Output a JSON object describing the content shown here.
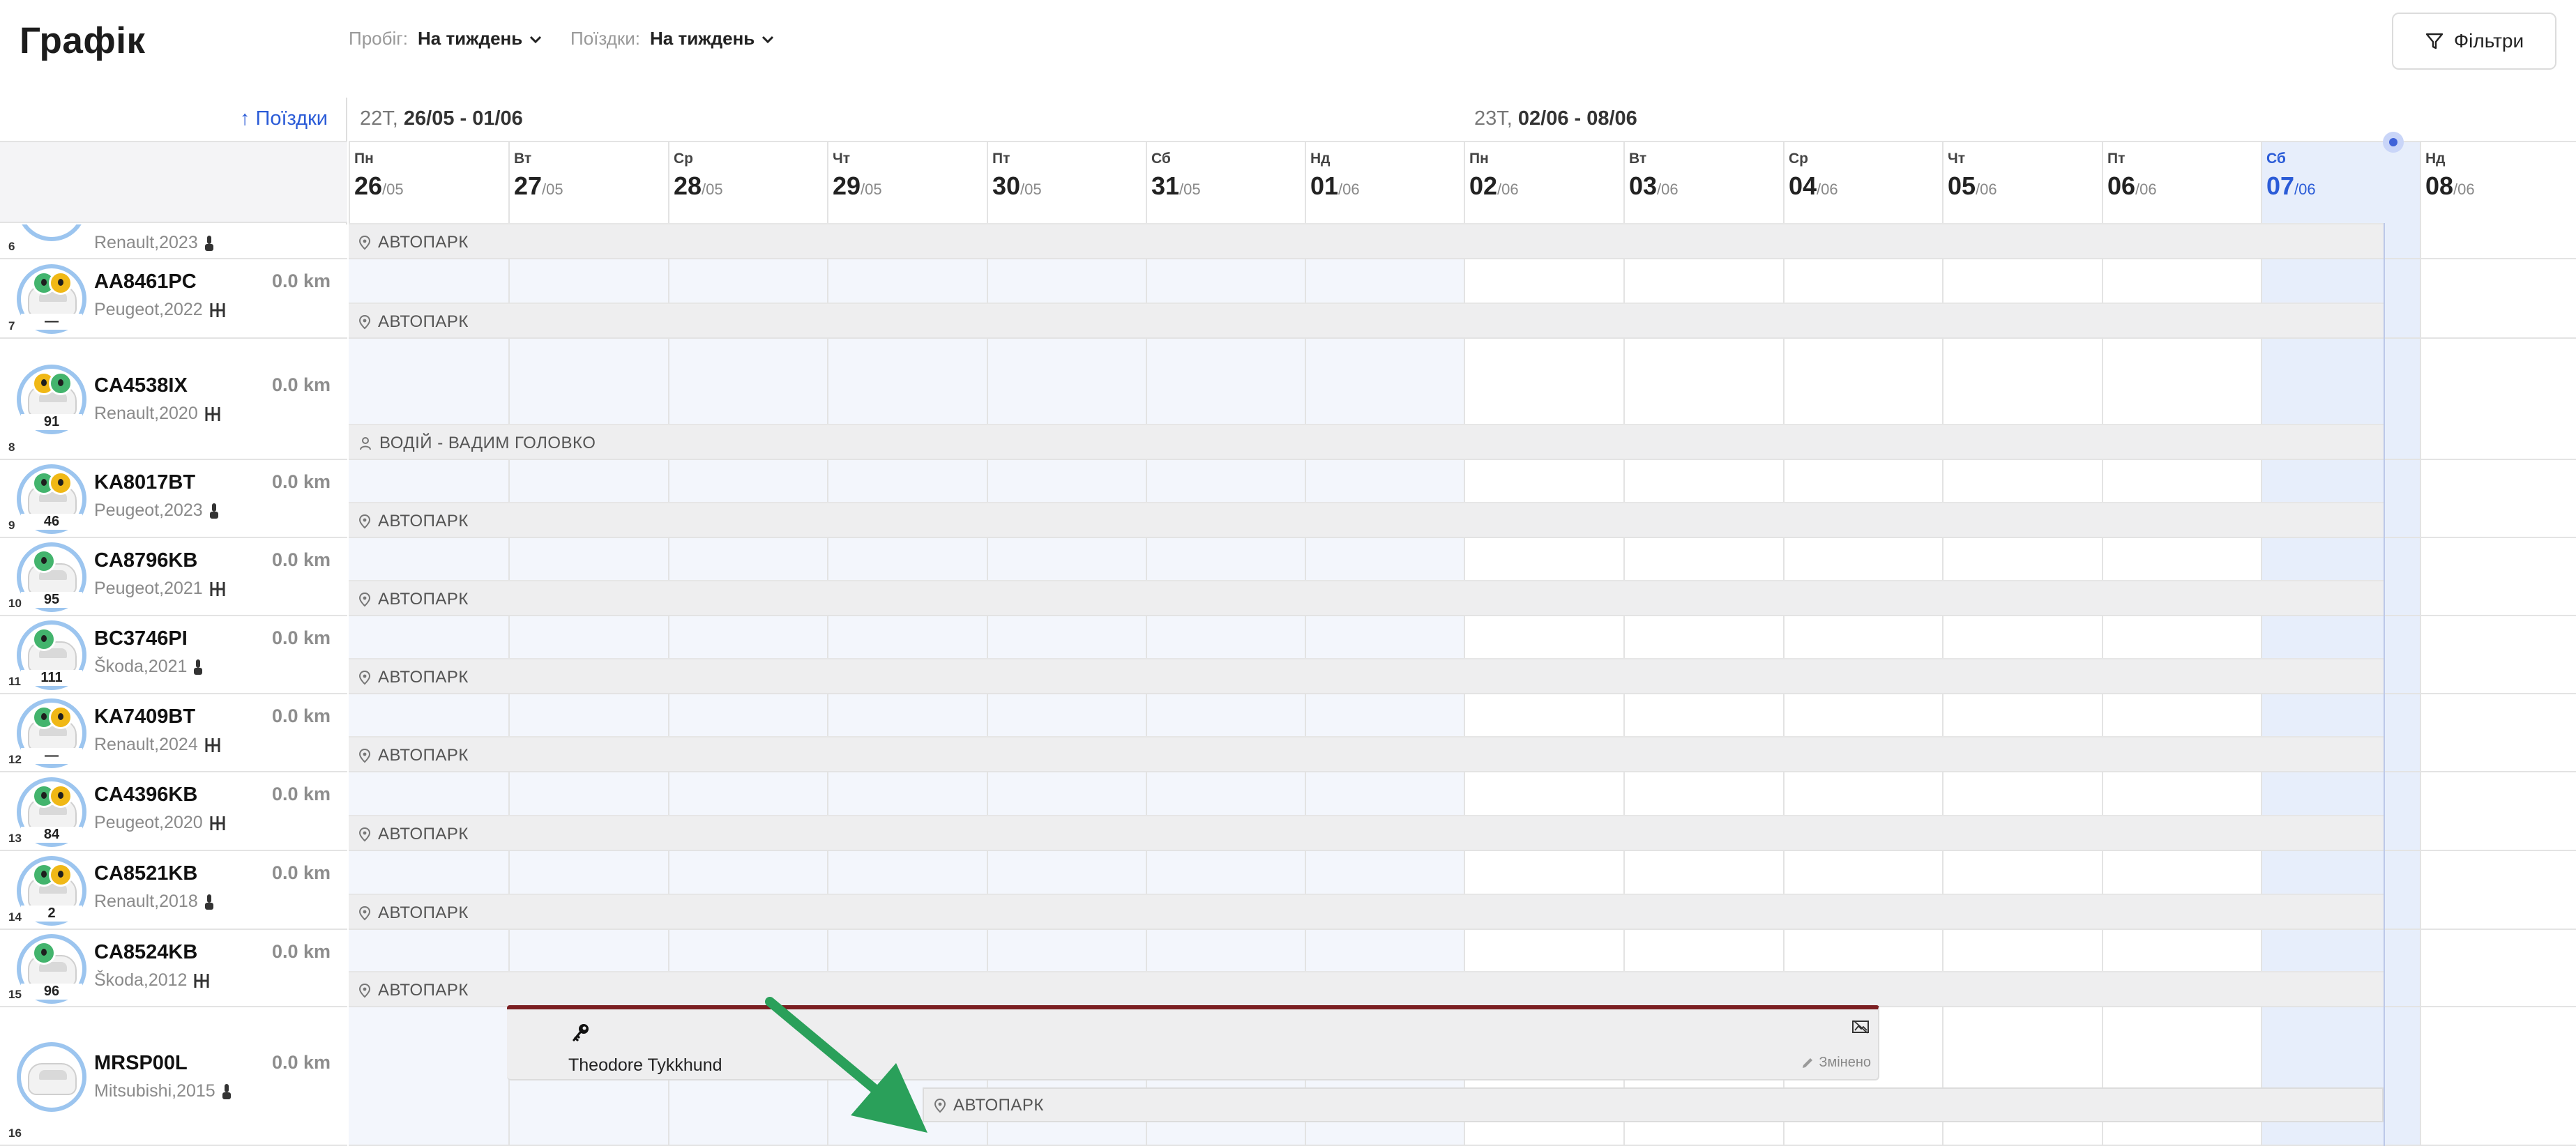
{
  "header": {
    "title": "Графік",
    "mileage_label": "Пробіг:",
    "mileage_value": "На тиждень",
    "trips_label": "Поїздки:",
    "trips_value": "На тиждень",
    "filters_label": "Фільтри"
  },
  "left_panel": {
    "trips_sort_link": "↑ Поїздки"
  },
  "calendar": {
    "weeks": [
      {
        "prefix": "22Т, ",
        "range": "26/05 - 01/06"
      },
      {
        "prefix": "23Т, ",
        "range": "02/06 - 08/06"
      }
    ],
    "days": [
      {
        "name": "Пн",
        "day": "26",
        "month": "/05"
      },
      {
        "name": "Вт",
        "day": "27",
        "month": "/05"
      },
      {
        "name": "Ср",
        "day": "28",
        "month": "/05"
      },
      {
        "name": "Чт",
        "day": "29",
        "month": "/05"
      },
      {
        "name": "Пт",
        "day": "30",
        "month": "/05"
      },
      {
        "name": "Сб",
        "day": "31",
        "month": "/05"
      },
      {
        "name": "Нд",
        "day": "01",
        "month": "/06"
      },
      {
        "name": "Пн",
        "day": "02",
        "month": "/06"
      },
      {
        "name": "Вт",
        "day": "03",
        "month": "/06"
      },
      {
        "name": "Ср",
        "day": "04",
        "month": "/06"
      },
      {
        "name": "Чт",
        "day": "05",
        "month": "/06"
      },
      {
        "name": "Пт",
        "day": "06",
        "month": "/06"
      },
      {
        "name": "Сб",
        "day": "07",
        "month": "/06"
      },
      {
        "name": "Нд",
        "day": "08",
        "month": "/06"
      }
    ],
    "today_index": 12
  },
  "vehicles": [
    {
      "index": "6",
      "plate": "",
      "model": "Renault,2023",
      "km": "",
      "transmission": "auto",
      "score": "",
      "badges": []
    },
    {
      "index": "7",
      "plate": "AA8461PC",
      "model": "Peugeot,2022",
      "km": "0.0 km",
      "transmission": "manual",
      "score": "—",
      "badges": [
        "green",
        "yellow"
      ]
    },
    {
      "index": "8",
      "plate": "CA4538IX",
      "model": "Renault,2020",
      "km": "0.0 km",
      "transmission": "manual",
      "score": "91",
      "badges": [
        "yellow",
        "green"
      ]
    },
    {
      "index": "9",
      "plate": "KA8017BT",
      "model": "Peugeot,2023",
      "km": "0.0 km",
      "transmission": "auto",
      "score": "46",
      "badges": [
        "green",
        "yellow"
      ]
    },
    {
      "index": "10",
      "plate": "CA8796KB",
      "model": "Peugeot,2021",
      "km": "0.0 km",
      "transmission": "manual",
      "score": "95",
      "badges": [
        "green"
      ]
    },
    {
      "index": "11",
      "plate": "BC3746PI",
      "model": "Škoda,2021",
      "km": "0.0 km",
      "transmission": "auto",
      "score": "111",
      "badges": [
        "green"
      ]
    },
    {
      "index": "12",
      "plate": "KA7409BT",
      "model": "Renault,2024",
      "km": "0.0 km",
      "transmission": "manual",
      "score": "—",
      "badges": [
        "green",
        "yellow"
      ]
    },
    {
      "index": "13",
      "plate": "CA4396KB",
      "model": "Peugeot,2020",
      "km": "0.0 km",
      "transmission": "manual",
      "score": "84",
      "badges": [
        "green",
        "yellow"
      ]
    },
    {
      "index": "14",
      "plate": "CA8521KB",
      "model": "Renault,2018",
      "km": "0.0 km",
      "transmission": "auto",
      "score": "2",
      "badges": [
        "green",
        "yellow"
      ]
    },
    {
      "index": "15",
      "plate": "CA8524KB",
      "model": "Škoda,2012",
      "km": "0.0 km",
      "transmission": "manual",
      "score": "96",
      "badges": [
        "green"
      ]
    },
    {
      "index": "16",
      "plate": "MRSP00L",
      "model": "Mitsubishi,2015",
      "km": "0.0 km",
      "transmission": "auto",
      "score": "",
      "badges": []
    }
  ],
  "rows": [
    {
      "sub_label": "АВТОПАРК",
      "kind": "location"
    },
    {
      "sub_label": "АВТОПАРК",
      "kind": "location"
    },
    {
      "sub_label": "ВОДІЙ - ВАДИМ ГОЛОВКО",
      "kind": "driver"
    },
    {
      "sub_label": "АВТОПАРК",
      "kind": "location"
    },
    {
      "sub_label": "АВТОПАРК",
      "kind": "location"
    },
    {
      "sub_label": "АВТОПАРК",
      "kind": "location"
    },
    {
      "sub_label": "АВТОПАРК",
      "kind": "location"
    },
    {
      "sub_label": "АВТОПАРК",
      "kind": "location"
    },
    {
      "sub_label": "АВТОПАРК",
      "kind": "location"
    },
    {
      "sub_label": "АВТОПАРК",
      "kind": "location"
    },
    {
      "sub_label": "",
      "kind": "none"
    }
  ],
  "booking": {
    "name": "Theodore Tykkhund",
    "status": "Змінено",
    "sub_label": "АВТОПАРК"
  },
  "colors": {
    "accent": "#2a5bd7",
    "booking_bar": "#7b1f22",
    "arrow": "#2aa05a",
    "badge_green": "#43b46d",
    "badge_yellow": "#f0b816"
  }
}
